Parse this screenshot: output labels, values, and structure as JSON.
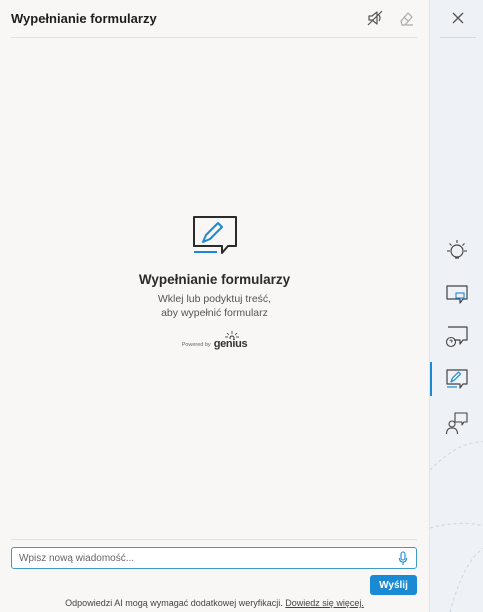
{
  "header": {
    "title": "Wypełnianie formularzy"
  },
  "empty_state": {
    "title": "Wypełnianie formularzy",
    "description_line1": "Wklej lub podyktuj treść,",
    "description_line2": "aby wypełnić formularz",
    "powered_by_label": "Powered by",
    "powered_by_brand": "genius"
  },
  "input": {
    "placeholder": "Wpisz nową wiadomość...",
    "value": ""
  },
  "send_button": {
    "label": "Wyślij"
  },
  "footer": {
    "note": "Odpowiedzi AI mogą wymagać dodatkowej weryfikacji.",
    "link": "Dowiedz się więcej."
  },
  "sidebar": {
    "items": [
      {
        "icon": "lightbulb-icon",
        "active": false
      },
      {
        "icon": "chat-icon",
        "active": false
      },
      {
        "icon": "chat-question-icon",
        "active": false
      },
      {
        "icon": "chat-edit-icon",
        "active": true
      },
      {
        "icon": "people-chat-icon",
        "active": false
      }
    ]
  },
  "colors": {
    "accent": "#1a8ad4",
    "input_border": "#3f9ac7",
    "background": "#f8f7f5",
    "sidebar_background": "#eef1f5"
  }
}
